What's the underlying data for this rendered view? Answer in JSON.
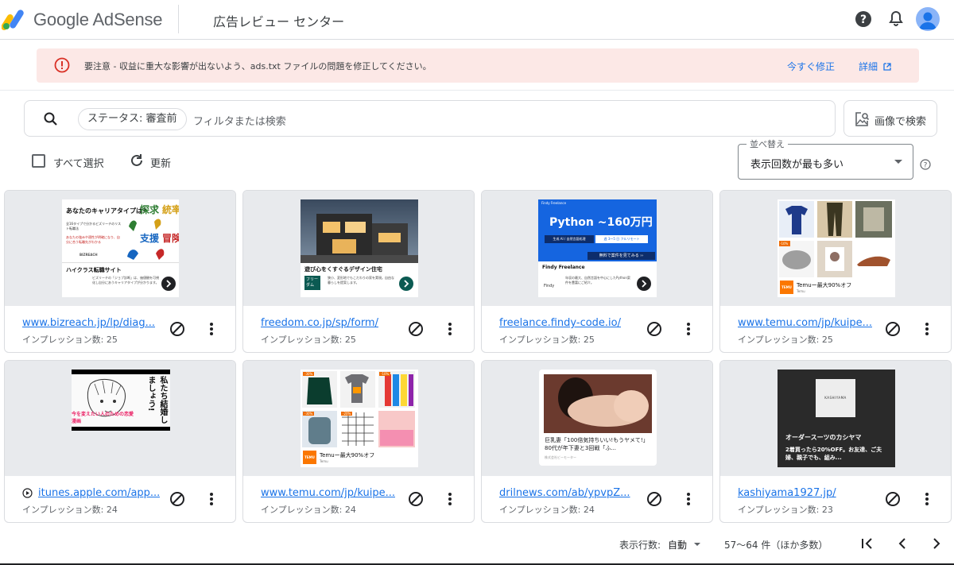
{
  "header": {
    "brand": "Google AdSense",
    "title": "広告レビュー センター"
  },
  "banner": {
    "message": "要注意 - 収益に重大な影響が出ないよう、ads.txt ファイルの問題を修正してください。",
    "fix_label": "今すぐ修正",
    "details_label": "詳細"
  },
  "search": {
    "chip": "ステータス: 審査前",
    "placeholder": "フィルタまたは検索",
    "image_search_label": "画像で検索"
  },
  "toolbar": {
    "select_all": "すべて選択",
    "refresh": "更新",
    "sort_label": "並べ替え",
    "sort_value": "表示回数が最も多い"
  },
  "cards": [
    {
      "url": "www.bizreach.jp/lp/diag...",
      "impressions": "インプレッション数: 25",
      "ad": {
        "headline": "あなたのキャリアタイプは?",
        "body": "全16タイプで分かるビズリーチのリスト転職法",
        "note": "あなたの強みや適性が明確になり、自分に合う転職先がわかる",
        "logo": "BIZREACH",
        "tiles": [
          "探求",
          "統率",
          "支援",
          "冒険"
        ],
        "title": "ハイクラス転職サイト",
        "sub": "ビズリーチの「ジョブ診断」は、価値観を可視化し自分にあうキャリアタイプが分かります。"
      }
    },
    {
      "url": "freedom.co.jp/sp/form/",
      "impressions": "インプレッション数: 25",
      "ad": {
        "title": "遊び心をくすぐるデザイン住宅",
        "logo": "フリーダム",
        "body": "狭小、変形地でもこだわりの家を実現。自由な暮らしを提案します。"
      }
    },
    {
      "url": "freelance.findy-code.io/",
      "impressions": "インプレッション数: 25",
      "ad": {
        "brand_tag": "Findy Freelance",
        "headline": "Python ~160万円",
        "sub1": "生成 AI / 自然言語処理",
        "sub2": "週 3〜5 日 フルリモート",
        "cta": "無料で案件を見てみる ››",
        "title": "Findy Freelance",
        "body": "年収の最大、自然言語を中心にしたPython案件を豊富にご紹介。",
        "logo": "Findy"
      }
    },
    {
      "url": "www.temu.com/jp/kuipe...",
      "impressions": "インプレッション数: 25",
      "ad": {
        "title": "Temuー最大90%オフ",
        "sub": "Temu",
        "badge": "-10%",
        "logo": "TEMU"
      }
    },
    {
      "url": "itunes.apple.com/app...",
      "impressions": "インプレッション数: 24",
      "ad": {
        "speech": "私たち結婚しましょう!",
        "caption": "今を変えたい人のための恋愛漫画"
      }
    },
    {
      "url": "www.temu.com/jp/kuipe...",
      "impressions": "インプレッション数: 24",
      "ad": {
        "title": "Temuー最大90%オフ",
        "sub": "Temu",
        "badges": [
          "-30%",
          "-10%",
          "-30%",
          "-20%"
        ],
        "logo": "TEMU"
      }
    },
    {
      "url": "drilnews.com/ab/ypvpZ...",
      "impressions": "インプレッション数: 24",
      "ad": {
        "title": "巨乳妻「100倍気持ちいい!もうヤメて!」80代が年下妻と3回戦「ふ...",
        "sub": "株式会社ビーモーター"
      }
    },
    {
      "url": "kashiyama1927.jp/",
      "impressions": "インプレッション数: 23",
      "ad": {
        "logo": "KASHIYAMA",
        "title": "オーダースーツのカシヤマ",
        "body": "2着買ったら20%OFF。お友達、ご夫婦、親子でも、組み..."
      }
    }
  ],
  "footer": {
    "rows_label": "表示行数:",
    "rows_value": "自動",
    "range": "57〜64 件（ほか多数）"
  },
  "colors": {
    "accent": "#1a73e8",
    "banner_bg": "#fce8e6",
    "warn": "#d93025",
    "thumb_bg": "#e8eaed"
  },
  "icons": {
    "logo": "adsense-logo",
    "help": "help-icon",
    "bell": "bell-icon",
    "warning": "warning-icon",
    "search": "search-icon",
    "image_search": "image-search-icon",
    "refresh": "refresh-icon",
    "block": "block-icon",
    "more": "more-vert-icon",
    "first": "first-page-icon",
    "prev": "chevron-left-icon",
    "next": "chevron-right-icon"
  }
}
